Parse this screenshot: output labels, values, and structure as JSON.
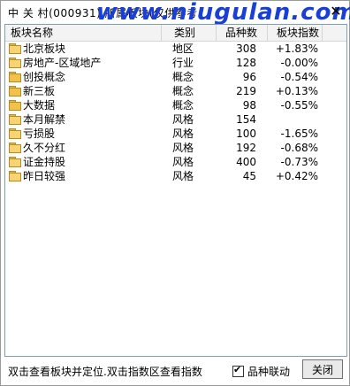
{
  "window": {
    "title": "中 关 村(000931)  所属板块(仅供参考",
    "watermark": "www.niugulan.com",
    "close_glyph": "✕"
  },
  "table": {
    "columns": [
      "板块名称",
      "类别",
      "品种数",
      "板块指数"
    ],
    "rows": [
      {
        "name": "北京板块",
        "category": "地区",
        "count": "308",
        "index": "+1.83%",
        "folder": "closed"
      },
      {
        "name": "房地产-区域地产",
        "category": "行业",
        "count": "128",
        "index": "-0.00%",
        "folder": "closed"
      },
      {
        "name": "创投概念",
        "category": "概念",
        "count": "96",
        "index": "-0.54%",
        "folder": "open"
      },
      {
        "name": "新三板",
        "category": "概念",
        "count": "219",
        "index": "+0.13%",
        "folder": "open"
      },
      {
        "name": "大数据",
        "category": "概念",
        "count": "98",
        "index": "-0.55%",
        "folder": "open"
      },
      {
        "name": "本月解禁",
        "category": "风格",
        "count": "154",
        "index": "",
        "folder": "closed"
      },
      {
        "name": "亏损股",
        "category": "风格",
        "count": "100",
        "index": "-1.65%",
        "folder": "closed"
      },
      {
        "name": "久不分红",
        "category": "风格",
        "count": "192",
        "index": "-0.68%",
        "folder": "closed"
      },
      {
        "name": "证金持股",
        "category": "风格",
        "count": "400",
        "index": "-0.73%",
        "folder": "closed"
      },
      {
        "name": "昨日较强",
        "category": "风格",
        "count": "45",
        "index": "+0.42%",
        "folder": "closed"
      }
    ]
  },
  "footer": {
    "status": "双击查看板块并定位.双击指数区查看指数",
    "checkbox_label": "品种联动",
    "checkbox_checked": true,
    "close_label": "关闭"
  }
}
